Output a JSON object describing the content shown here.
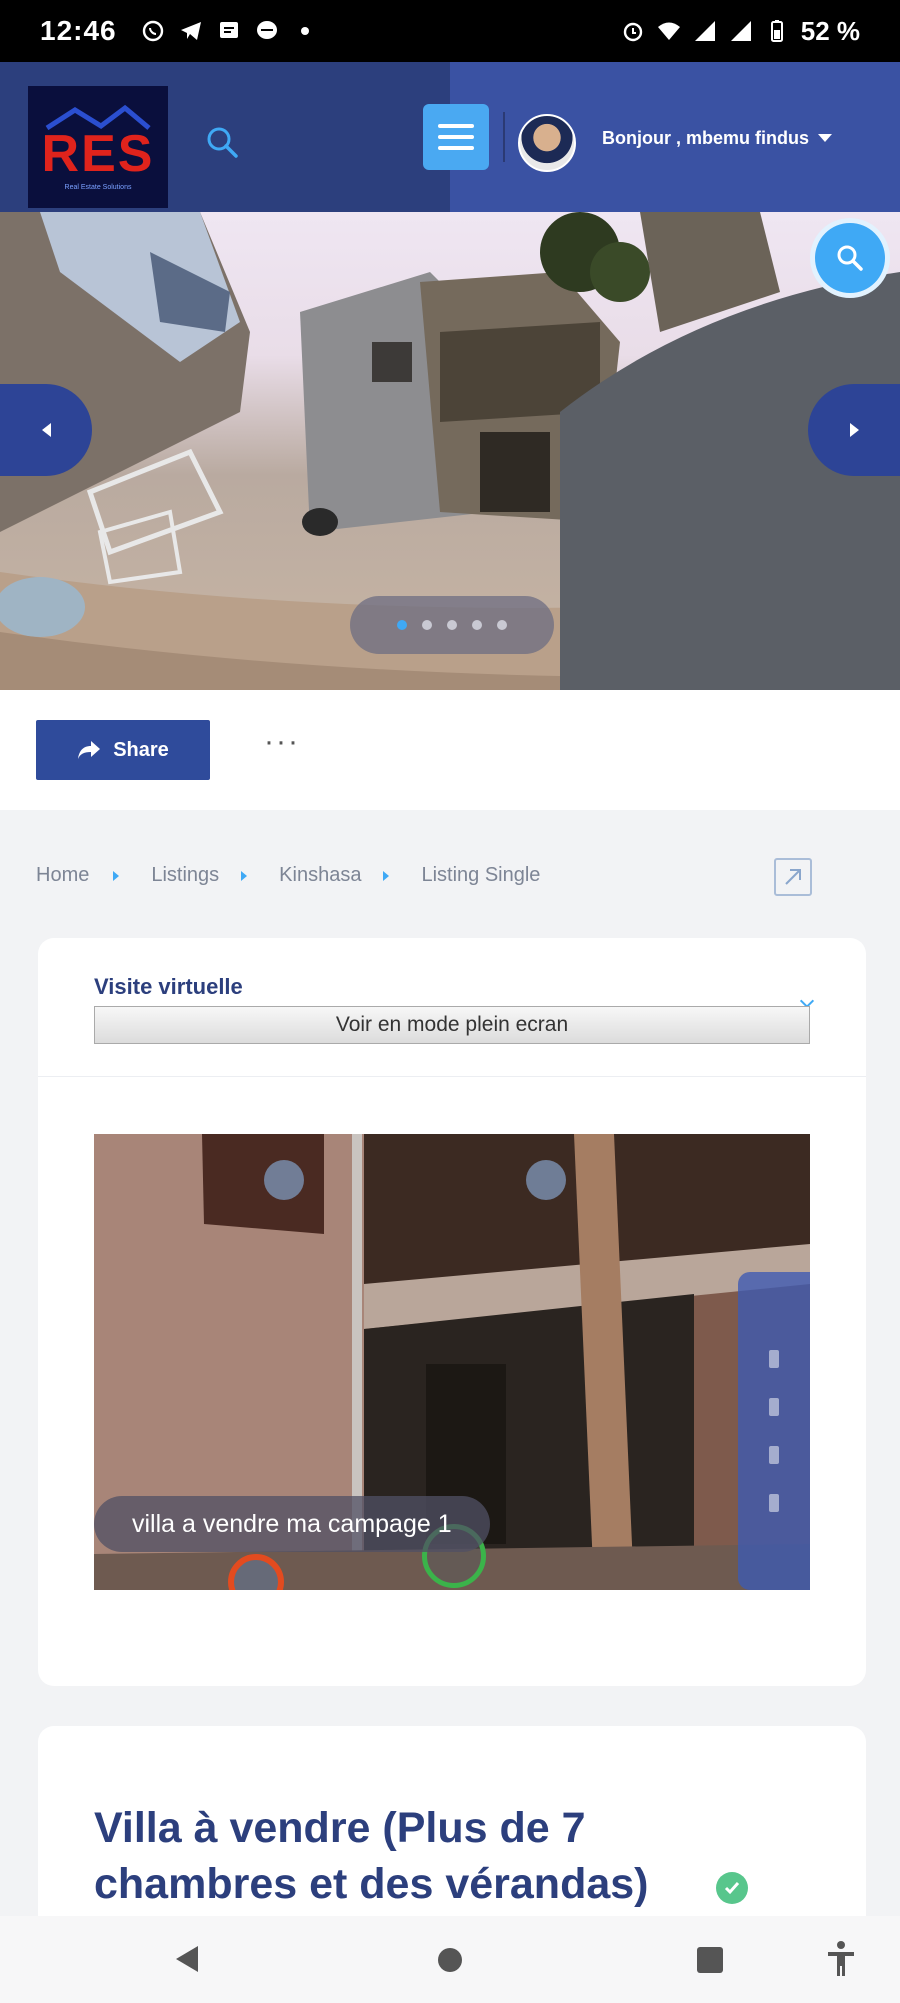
{
  "status_bar": {
    "time": "12:46",
    "battery": "52 %"
  },
  "header": {
    "logo_text": "RES",
    "logo_subtitle": "Real Estate Solutions",
    "greeting": "Bonjour , mbemu findus"
  },
  "hero": {
    "total_slides": 5,
    "active_slide": 1
  },
  "actions": {
    "share_label": "Share",
    "more_label": "···"
  },
  "breadcrumb": {
    "items": [
      "Home",
      "Listings",
      "Kinshasa",
      "Listing Single"
    ]
  },
  "virtual_tour": {
    "title": "Visite virtuelle",
    "fullscreen_label": "Voir en mode plein ecran",
    "caption": "villa a vendre ma campage 1"
  },
  "listing": {
    "title": "Villa à vendre (Plus de 7 chambres et des vérandas)"
  },
  "colors": {
    "brand_dark": "#2c3f7d",
    "accent_blue": "#3fa9f5",
    "verified_green": "#58c68c"
  }
}
